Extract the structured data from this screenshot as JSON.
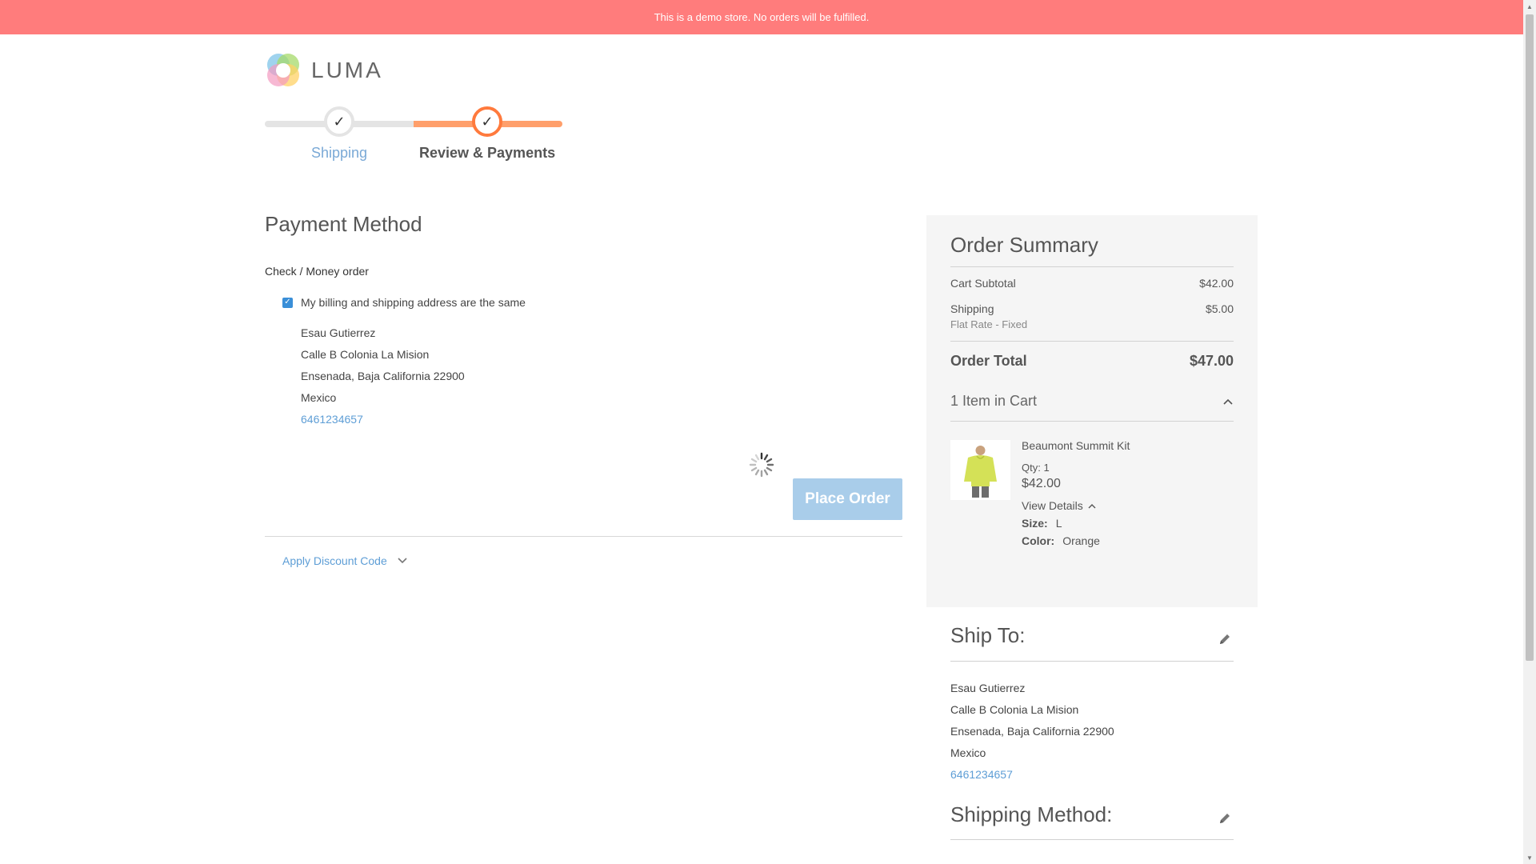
{
  "notice": {
    "text": "This is a demo store. No orders will be fulfilled."
  },
  "logo": {
    "text": "LUMA"
  },
  "progress": {
    "steps": [
      {
        "label": "Shipping",
        "state": "complete"
      },
      {
        "label": "Review & Payments",
        "state": "active"
      }
    ]
  },
  "payment": {
    "title": "Payment Method",
    "method_label": "Check / Money order",
    "same_address_label": "My billing and shipping address are the same",
    "same_address_checked": true,
    "address": {
      "name": "Esau Gutierrez",
      "street": "Calle B Colonia La Mision",
      "city_line": "Ensenada, Baja California 22900",
      "country": "Mexico",
      "phone": "6461234657"
    },
    "place_order_label": "Place Order",
    "discount_label": "Apply Discount Code"
  },
  "summary": {
    "title": "Order Summary",
    "cart_subtotal_label": "Cart Subtotal",
    "cart_subtotal_value": "$42.00",
    "shipping_label": "Shipping",
    "shipping_value": "$5.00",
    "shipping_method": "Flat Rate - Fixed",
    "order_total_label": "Order Total",
    "order_total_value": "$47.00",
    "items_in_cart_label": "1 Item in Cart",
    "item": {
      "name": "Beaumont Summit Kit",
      "qty_label": "Qty:",
      "qty_value": "1",
      "price": "$42.00",
      "view_details_label": "View Details",
      "size_label": "Size:",
      "size_value": "L",
      "color_label": "Color:",
      "color_value": "Orange"
    }
  },
  "ship_to": {
    "title": "Ship To:",
    "name": "Esau Gutierrez",
    "street": "Calle B Colonia La Mision",
    "city_line": "Ensenada, Baja California 22900",
    "country": "Mexico",
    "phone": "6461234657"
  },
  "shipping_method": {
    "title": "Shipping Method:"
  },
  "colors": {
    "notice_bg": "#ff7c7c",
    "accent_orange": "#ff7a3d",
    "link_blue": "#5e9ed6",
    "button_disabled": "#a9cdea"
  }
}
